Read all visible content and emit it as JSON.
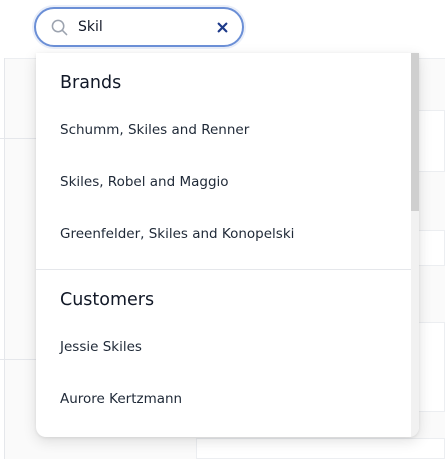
{
  "search": {
    "value": "Skil",
    "icon": "search-icon",
    "clear_icon": "close-icon",
    "border_color": "#6b8fd6",
    "clear_color": "#1e3a8a"
  },
  "dropdown": {
    "groups": [
      {
        "heading": "Brands",
        "items": [
          "Schumm, Skiles and Renner",
          "Skiles, Robel and Maggio",
          "Greenfelder, Skiles and Konopelski"
        ]
      },
      {
        "heading": "Customers",
        "items": [
          "Jessie Skiles",
          "Aurore Kertzmann"
        ]
      }
    ]
  }
}
